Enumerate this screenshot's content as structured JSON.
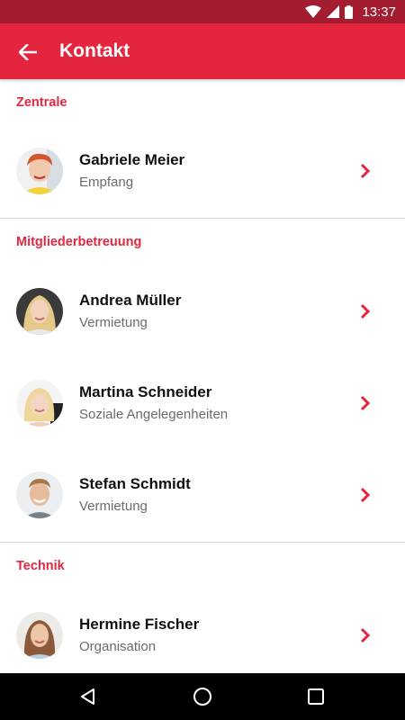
{
  "status_bar": {
    "time": "13:37"
  },
  "app_bar": {
    "title": "Kontakt",
    "back_icon": "arrow-left-icon"
  },
  "accent_color": "#e3263e",
  "sections": [
    {
      "title": "Zentrale",
      "contacts": [
        {
          "name": "Gabriele Meier",
          "role": "Empfang"
        }
      ]
    },
    {
      "title": "Mitgliederbetreuung",
      "contacts": [
        {
          "name": "Andrea Müller",
          "role": "Vermietung"
        },
        {
          "name": "Martina Schneider",
          "role": "Soziale Angelegenheiten"
        },
        {
          "name": "Stefan Schmidt",
          "role": "Vermietung"
        }
      ]
    },
    {
      "title": "Technik",
      "contacts": [
        {
          "name": "Hermine Fischer",
          "role": "Organisation"
        }
      ]
    }
  ],
  "nav_bar": {
    "icons": [
      "back-triangle-icon",
      "home-circle-icon",
      "recents-square-icon"
    ]
  }
}
